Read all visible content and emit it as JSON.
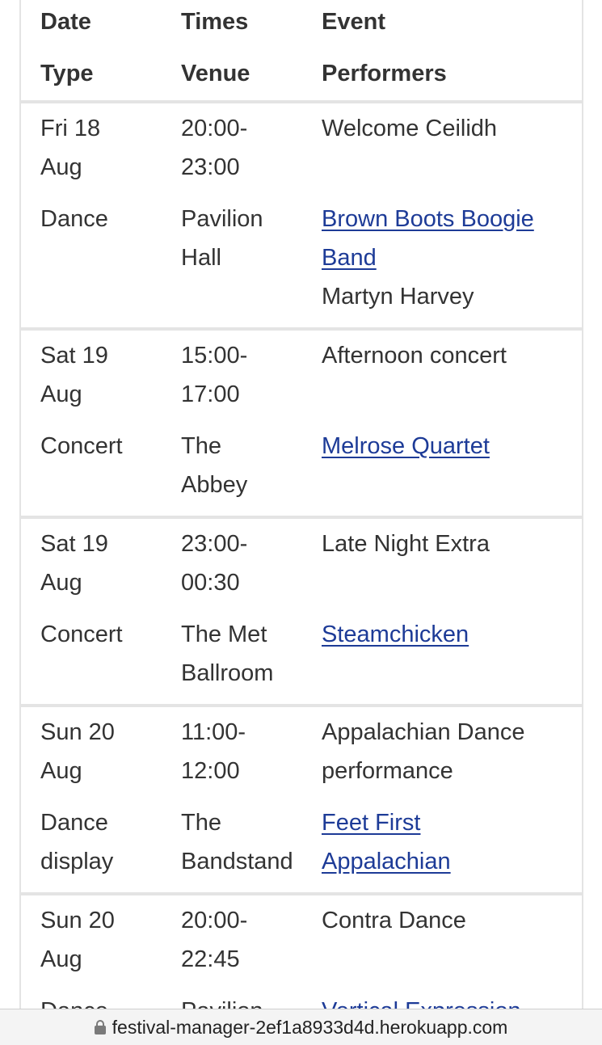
{
  "table": {
    "headers": {
      "date": "Date",
      "type": "Type",
      "times": "Times",
      "venue": "Venue",
      "event": "Event",
      "performers": "Performers"
    },
    "rows": [
      {
        "date": [
          "Fri 18",
          "Aug"
        ],
        "times": [
          "20:00-",
          "23:00"
        ],
        "event": [
          "Welcome Ceilidh"
        ],
        "type": [
          "Dance"
        ],
        "venue": [
          "Pavilion",
          "Hall"
        ],
        "performers": [
          {
            "lines": [
              "Brown Boots Boogie",
              "Band"
            ],
            "link": true
          },
          {
            "lines": [
              "Martyn Harvey"
            ],
            "link": false
          }
        ]
      },
      {
        "date": [
          "Sat 19",
          "Aug"
        ],
        "times": [
          "15:00-",
          "17:00"
        ],
        "event": [
          "Afternoon concert"
        ],
        "type": [
          "Concert"
        ],
        "venue": [
          "The",
          "Abbey"
        ],
        "performers": [
          {
            "lines": [
              "Melrose Quartet"
            ],
            "link": true
          }
        ]
      },
      {
        "date": [
          "Sat 19",
          "Aug"
        ],
        "times": [
          "23:00-",
          "00:30"
        ],
        "event": [
          "Late Night Extra"
        ],
        "type": [
          "Concert"
        ],
        "venue": [
          "The Met",
          "Ballroom"
        ],
        "performers": [
          {
            "lines": [
              "Steamchicken"
            ],
            "link": true
          }
        ]
      },
      {
        "date": [
          "Sun 20",
          "Aug"
        ],
        "times": [
          "11:00-",
          "12:00"
        ],
        "event": [
          "Appalachian Dance",
          "performance"
        ],
        "type": [
          "Dance",
          "display"
        ],
        "venue": [
          "The",
          "Bandstand"
        ],
        "performers": [
          {
            "lines": [
              "Feet First",
              "Appalachian"
            ],
            "link": true
          }
        ]
      },
      {
        "date": [
          "Sun 20",
          "Aug"
        ],
        "times": [
          "20:00-",
          "22:45"
        ],
        "event": [
          "Contra Dance"
        ],
        "type": [
          "Dance"
        ],
        "venue": [
          "Pavilion"
        ],
        "performers": [
          {
            "lines": [
              "Vertical Expression"
            ],
            "link": true
          }
        ]
      }
    ]
  },
  "browser": {
    "url": "festival-manager-2ef1a8933d4d.herokuapp.com",
    "lock_icon": "lock-icon"
  }
}
